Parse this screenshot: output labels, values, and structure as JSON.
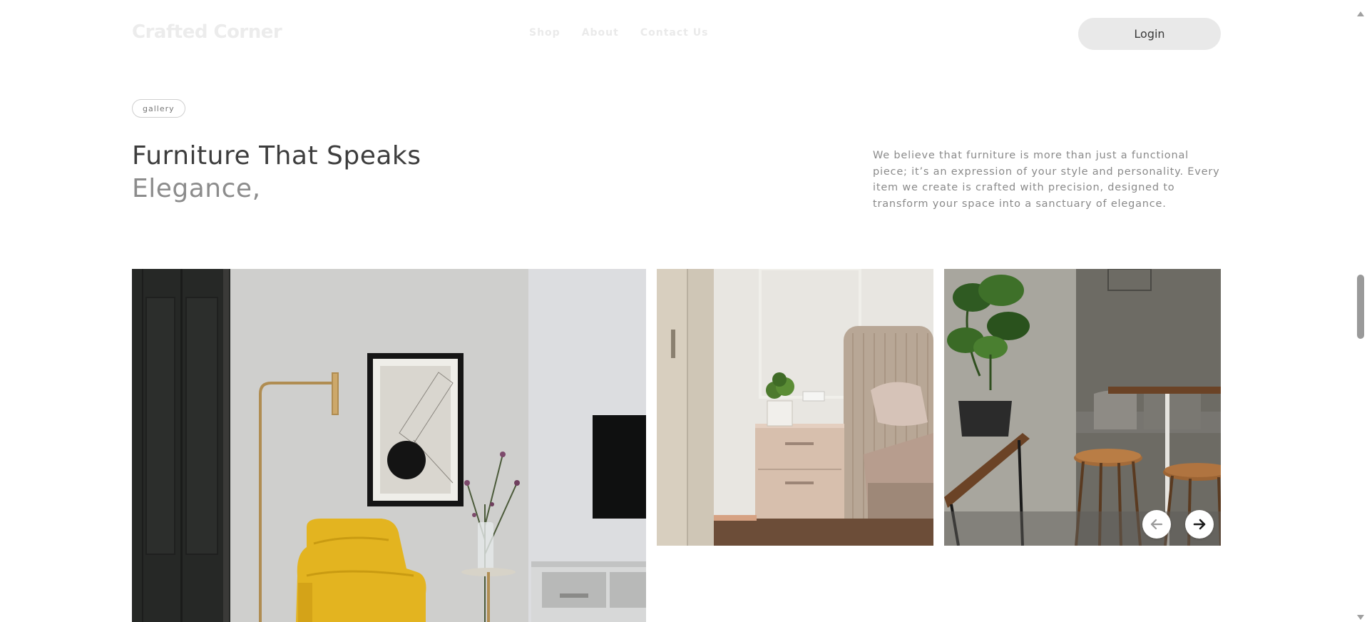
{
  "header": {
    "brand": "Crafted Corner",
    "nav": [
      {
        "label": "Shop"
      },
      {
        "label": "About"
      },
      {
        "label": "Contact Us"
      }
    ],
    "login_label": "Login"
  },
  "gallery": {
    "badge": "gallery",
    "title_line1": "Furniture That Speaks",
    "title_line2": "Elegance,",
    "description": "We believe that furniture is more than just a functional piece; it’s an expression of your style and personality. Every item we create is crafted with precision, designed to transform your space into a sanctuary of elegance.",
    "images": [
      {
        "name": "living-room-yellow-armchair"
      },
      {
        "name": "bedroom-nightstand"
      },
      {
        "name": "cafe-plant-stools"
      }
    ],
    "controls": {
      "prev_icon": "arrow-left-icon",
      "next_icon": "arrow-right-icon"
    }
  },
  "colors": {
    "accent_yellow": "#e3b420",
    "text_dark": "#3d3d3d",
    "text_muted": "#8a8a8a",
    "button_bg": "#e9e9e9"
  }
}
